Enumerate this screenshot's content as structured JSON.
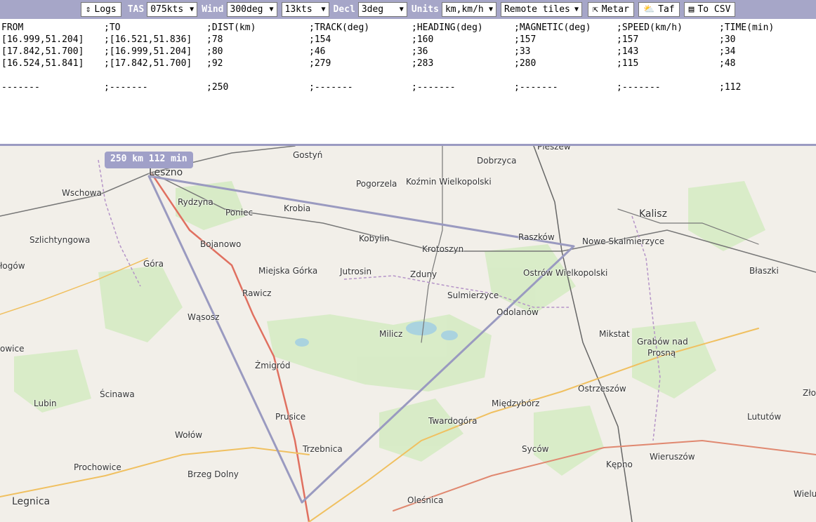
{
  "toolbar": {
    "logs_label": "Logs",
    "tas_label": "TAS",
    "tas_value": "075kts",
    "wind_label": "Wind",
    "wind_dir_value": "300deg",
    "wind_speed_value": "13kts",
    "decl_label": "Decl",
    "decl_value": "3deg",
    "units_label": "Units",
    "units_value": "km,km/h",
    "tiles_value": "Remote tiles",
    "metar_label": "Metar",
    "taf_label": "Taf",
    "csv_label": "To CSV"
  },
  "table": {
    "headers": [
      "FROM",
      ";TO",
      ";DIST(km)",
      ";TRACK(deg)",
      ";HEADING(deg)",
      ";MAGNETIC(deg)",
      ";SPEED(km/h)",
      ";TIME(min)"
    ],
    "rows": [
      [
        "[16.999,51.204]",
        ";[16.521,51.836]",
        ";78",
        ";154",
        ";160",
        ";157",
        ";157",
        ";30"
      ],
      [
        "[17.842,51.700]",
        ";[16.999,51.204]",
        ";80",
        ";46",
        ";36",
        ";33",
        ";143",
        ";34"
      ],
      [
        "[16.524,51.841]",
        ";[17.842,51.700]",
        ";92",
        ";279",
        ";283",
        ";280",
        ";115",
        ";48"
      ]
    ],
    "totals": [
      "-------",
      ";-------",
      ";250",
      ";-------",
      ";-------",
      ";-------",
      ";-------",
      ";112"
    ]
  },
  "map": {
    "tooltip": "250 km 112 min",
    "route_color": "#9a9ac0",
    "places": [
      {
        "name": "Pleszew"
      },
      {
        "name": "Gostyń"
      },
      {
        "name": "Dobrzyca"
      },
      {
        "name": "Leszno"
      },
      {
        "name": "Wschowa"
      },
      {
        "name": "Pogorzela"
      },
      {
        "name": "Koźmin Wielkopolski"
      },
      {
        "name": "Rydzyna"
      },
      {
        "name": "Kalisz"
      },
      {
        "name": "Poniec"
      },
      {
        "name": "Krobia"
      },
      {
        "name": "Szlichtyngowa"
      },
      {
        "name": "Kobylin"
      },
      {
        "name": "Raszków"
      },
      {
        "name": "Nowe Skalmierzyce"
      },
      {
        "name": "Bojanowo"
      },
      {
        "name": "Krotoszyn"
      },
      {
        "name": "łogów"
      },
      {
        "name": "Góra"
      },
      {
        "name": "Miejska Górka"
      },
      {
        "name": "Jutrosin"
      },
      {
        "name": "Zduny"
      },
      {
        "name": "Ostrów Wielkopolski"
      },
      {
        "name": "Błaszki"
      },
      {
        "name": "Rawicz"
      },
      {
        "name": "Sulmierzyce"
      },
      {
        "name": "Odolanów"
      },
      {
        "name": "Wąsosz"
      },
      {
        "name": "Milicz"
      },
      {
        "name": "Mikstat"
      },
      {
        "name": "Grabów nad"
      },
      {
        "name": "Prosną"
      },
      {
        "name": "owice"
      },
      {
        "name": "Żmigród"
      },
      {
        "name": "Ostrzeszów"
      },
      {
        "name": "Ścinawa"
      },
      {
        "name": "Lubin"
      },
      {
        "name": "Międzybórz"
      },
      {
        "name": "Złoc"
      },
      {
        "name": "Prusice"
      },
      {
        "name": "Twardogóra"
      },
      {
        "name": "Lututów"
      },
      {
        "name": "Wołów"
      },
      {
        "name": "Trzebnica"
      },
      {
        "name": "Syców"
      },
      {
        "name": "Prochowice"
      },
      {
        "name": "Kępno"
      },
      {
        "name": "Wieruszów"
      },
      {
        "name": "Brzeg Dolny"
      },
      {
        "name": "Legnica"
      },
      {
        "name": "Oleśnica"
      },
      {
        "name": "Wielu"
      }
    ]
  }
}
